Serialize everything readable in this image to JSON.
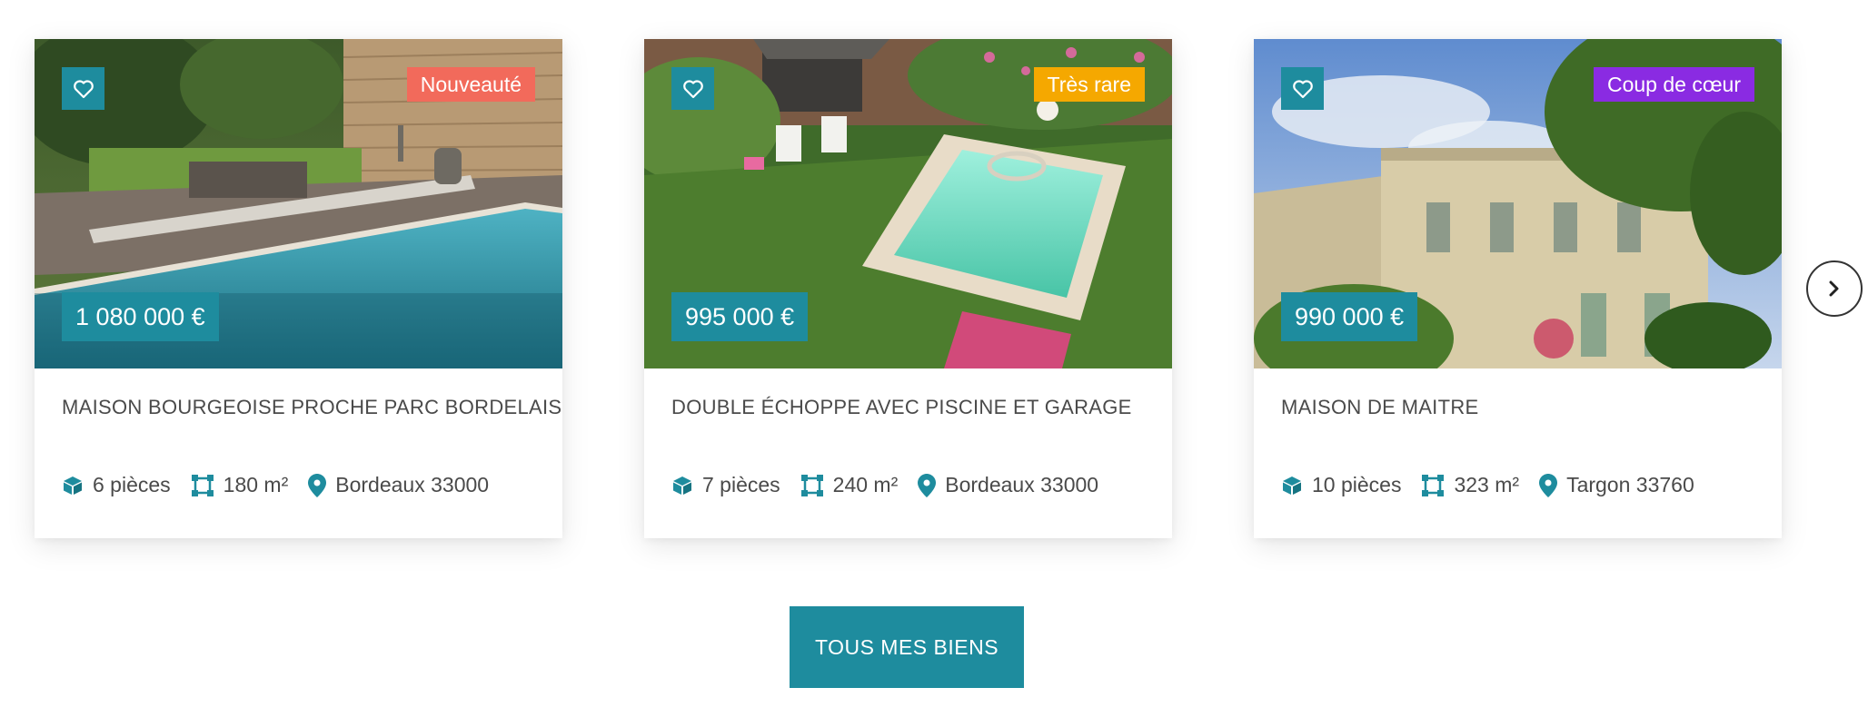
{
  "listings": [
    {
      "badge": "Nouveauté",
      "badge_color": "#f26a5b",
      "price": "1 080 000 €",
      "title": "MAISON BOURGEOISE PROCHE PARC BORDELAIS",
      "rooms": "6 pièces",
      "area": "180 m²",
      "location": "Bordeaux 33000"
    },
    {
      "badge": "Très rare",
      "badge_color": "#f5a800",
      "price": "995 000 €",
      "title": "DOUBLE ÉCHOPPE AVEC PISCINE ET GARAGE",
      "rooms": "7 pièces",
      "area": "240 m²",
      "location": "Bordeaux 33000"
    },
    {
      "badge": "Coup de cœur",
      "badge_color": "#8a2be2",
      "price": "990 000 €",
      "title": "MAISON DE MAITRE",
      "rooms": "10 pièces",
      "area": "323 m²",
      "location": "Targon 33760"
    }
  ],
  "icons": {
    "favorite": "heart-icon",
    "rooms": "cube-icon",
    "area": "surface-icon",
    "location": "map-pin-icon",
    "next": "chevron-right-icon"
  },
  "colors": {
    "accent": "#1e8c9e"
  },
  "cta": {
    "label": "TOUS MES BIENS"
  }
}
